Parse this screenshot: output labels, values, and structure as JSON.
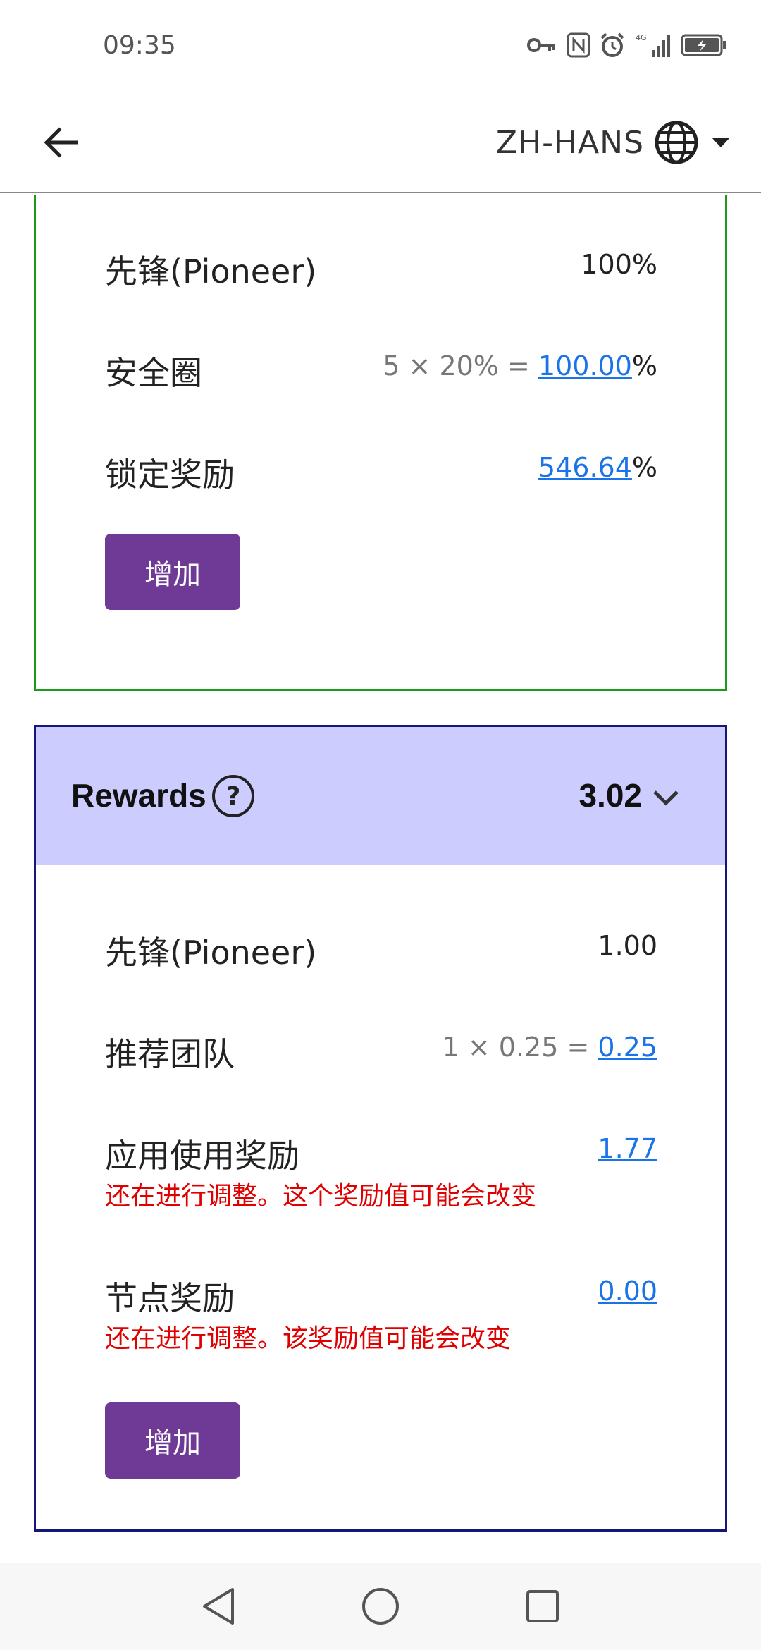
{
  "status_bar": {
    "time": "09:35",
    "icons": [
      "key-icon",
      "nfc-icon",
      "alarm-icon",
      "signal-icon",
      "battery-icon"
    ],
    "signal_label": "4G"
  },
  "app_bar": {
    "back_icon": "arrow-left-icon",
    "language": "ZH-HANS",
    "language_icon": "globe-icon",
    "dropdown_icon": "triangle-down-icon"
  },
  "lockup_card": {
    "border_color": "#1a9c1a",
    "rows": [
      {
        "label": "先锋(Pioneer)",
        "value": "100%"
      },
      {
        "label": "安全圈",
        "formula": "5 × 20% = ",
        "value": "100.00",
        "suffix": "%"
      },
      {
        "label": "锁定奖励",
        "value": "546.64",
        "suffix": "%"
      }
    ],
    "add_label": "增加"
  },
  "rewards_card": {
    "border_color": "#15157a",
    "header_bg": "#ccccff",
    "title": "Rewards",
    "help_glyph": "?",
    "total": "3.02",
    "rows": [
      {
        "label": "先锋(Pioneer)",
        "value": "1.00"
      },
      {
        "label": "推荐团队",
        "formula": "1 × 0.25 = ",
        "value": "0.25"
      },
      {
        "label": "应用使用奖励",
        "value": "1.77",
        "note": "还在进行调整。这个奖励值可能会改变"
      },
      {
        "label": "节点奖励",
        "value": "0.00",
        "note": "还在进行调整。该奖励值可能会改变"
      }
    ],
    "add_label": "增加"
  },
  "colors": {
    "accent_button": "#6f3a95",
    "link": "#1a73e8",
    "warning_text": "#e00000"
  },
  "nav_bar": {
    "icons": [
      "back-triangle-icon",
      "home-circle-icon",
      "recents-square-icon"
    ]
  }
}
